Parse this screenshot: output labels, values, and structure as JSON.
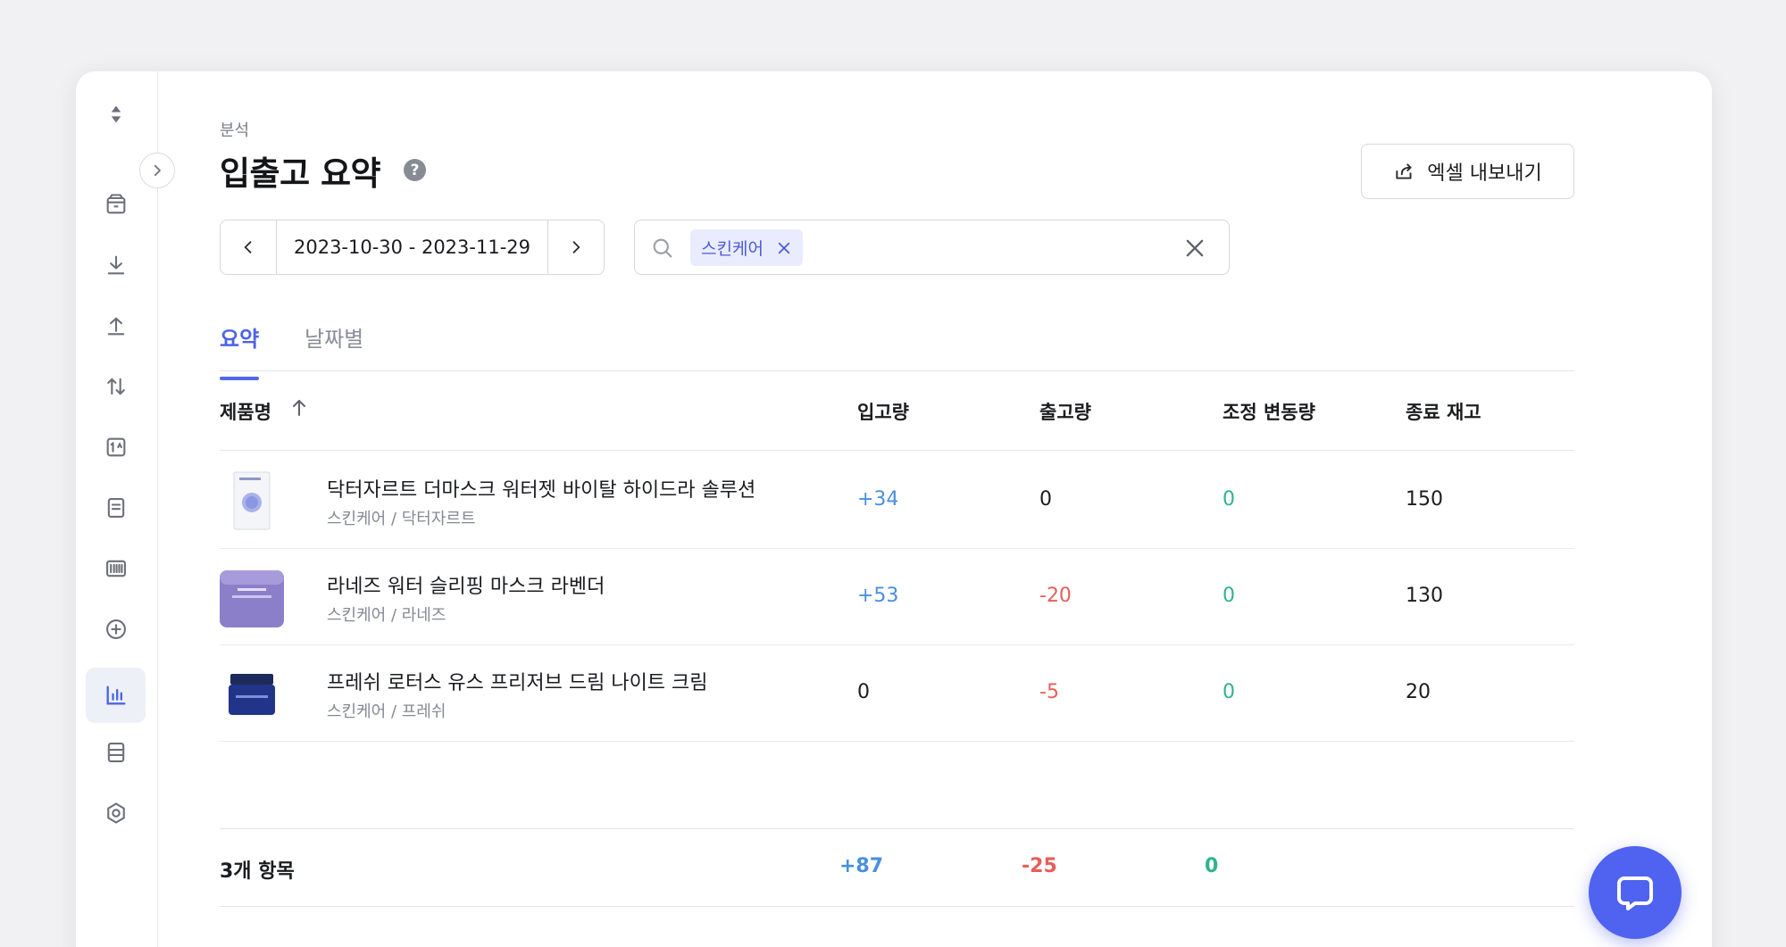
{
  "page": {
    "breadcrumb": "분석",
    "title": "입출고 요약",
    "help_glyph": "?",
    "export_label": "엑셀 내보내기"
  },
  "filters": {
    "date_range": "2023-10-30 - 2023-11-29",
    "search_chip": "스킨케어"
  },
  "tabs": [
    {
      "label": "요약",
      "active": true
    },
    {
      "label": "날짜별",
      "active": false
    }
  ],
  "table": {
    "columns": [
      "제품명",
      "입고량",
      "출고량",
      "조정 변동량",
      "종료 재고"
    ],
    "rows": [
      {
        "name": "닥터자르트 더마스크 워터젯 바이탈 하이드라 솔루션",
        "category": "스킨케어 / 닥터자르트",
        "in": "+34",
        "out": "0",
        "adjust": "0",
        "end": "150"
      },
      {
        "name": "라네즈 워터 슬리핑 마스크 라벤더",
        "category": "스킨케어 / 라네즈",
        "in": "+53",
        "out": "-20",
        "adjust": "0",
        "end": "130"
      },
      {
        "name": "프레쉬 로터스 유스 프리저브 드림 나이트 크림",
        "category": "스킨케어 / 프레쉬",
        "in": "0",
        "out": "-5",
        "adjust": "0",
        "end": "20"
      }
    ],
    "footer": {
      "count": "3개 항목",
      "in": "+87",
      "out": "-25",
      "adjust": "0"
    }
  },
  "sidebar": {
    "icons": [
      "sort-icon",
      "box-icon",
      "inbound-icon",
      "outbound-icon",
      "transfer-icon",
      "adjust-icon",
      "document-icon",
      "barcode-icon",
      "add-circle-icon",
      "bar-chart-icon",
      "list-icon",
      "settings-icon"
    ],
    "active": "bar-chart-icon"
  },
  "colors": {
    "accent": "#4c63e6",
    "positive": "#4a8fe0",
    "negative": "#e85e5a",
    "zero": "#2fb38e",
    "chat": "#4f63f0"
  }
}
